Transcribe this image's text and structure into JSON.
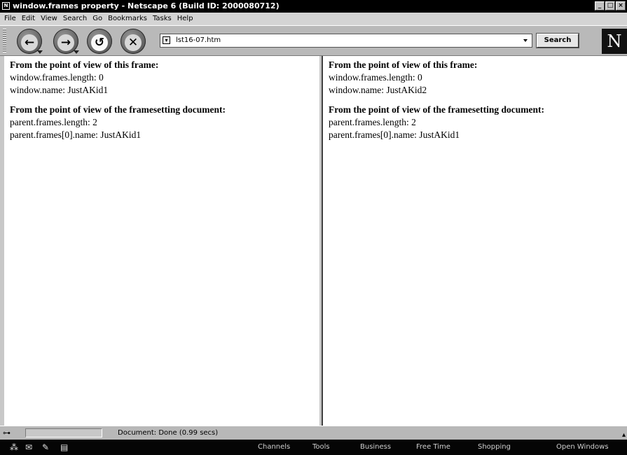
{
  "window": {
    "title": "window.frames property - Netscape 6 (Build ID: 2000080712)"
  },
  "window_buttons": {
    "minimize": "_",
    "maximize": "□",
    "close": "×"
  },
  "menu": [
    "File",
    "Edit",
    "View",
    "Search",
    "Go",
    "Bookmarks",
    "Tasks",
    "Help"
  ],
  "navigation": {
    "back_glyph": "←",
    "forward_glyph": "→",
    "reload_glyph": "↺",
    "stop_glyph": "✕",
    "url": "lst16-07.htm",
    "search_label": "Search",
    "logo": "N"
  },
  "frames": [
    {
      "heading1": "From the point of view of this frame:",
      "line1": "window.frames.length: 0",
      "line2": "window.name: JustAKid1",
      "heading2": "From the point of view of the framesetting document:",
      "line3": "parent.frames.length: 2",
      "line4": "parent.frames[0].name: JustAKid1"
    },
    {
      "heading1": "From the point of view of this frame:",
      "line1": "window.frames.length: 0",
      "line2": "window.name: JustAKid2",
      "heading2": "From the point of view of the framesetting document:",
      "line3": "parent.frames.length: 2",
      "line4": "parent.frames[0].name: JustAKid1"
    }
  ],
  "status": {
    "text": "Document: Done (0.99 secs)"
  },
  "taskbar": {
    "icons": [
      "navigator-icon",
      "mail-icon",
      "composer-icon",
      "address-book-icon"
    ],
    "links": [
      "Channels",
      "Tools",
      "Business",
      "Free Time",
      "Shopping",
      "Open Windows"
    ]
  },
  "colors": {
    "titlebar": "#000000",
    "toolbar": "#b9b9b9",
    "taskbar": "#050505"
  }
}
